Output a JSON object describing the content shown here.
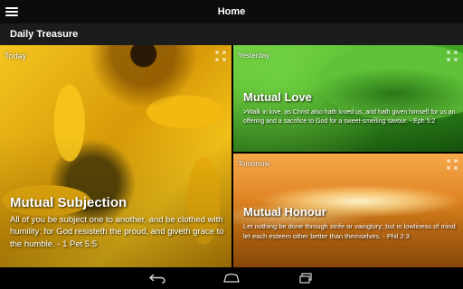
{
  "app": {
    "title": "Home",
    "section": "Daily Treasure"
  },
  "cards": {
    "today": {
      "label": "Today",
      "title": "Mutual Subjection",
      "text": "All of you be subject one to another, and be clothed with humility: for God resisteth the proud, and giveth grace to the humble. - 1 Pet 5:5"
    },
    "yesterday": {
      "label": "Yesterday",
      "title": "Mutual Love",
      "text": ">Walk in love, as Christ also hath loved us, and hath given himself for us an offering and a sacrifice to God for a sweet-smelling savour. - Eph 5:2"
    },
    "tomorrow": {
      "label": "Tomorrow",
      "title": "Mutual Honour",
      "text": "Let nothing be done through strife or vainglory; but in lowliness of mind let each esteem other better than themselves. - Phil 2:3"
    }
  },
  "icons": {
    "menu": "menu-icon",
    "expand": "expand-icon",
    "back": "back-icon",
    "home": "home-icon",
    "recents": "recents-icon"
  },
  "colors": {
    "topbar": "#0c0c0c",
    "subbar": "#1c1c1c"
  }
}
